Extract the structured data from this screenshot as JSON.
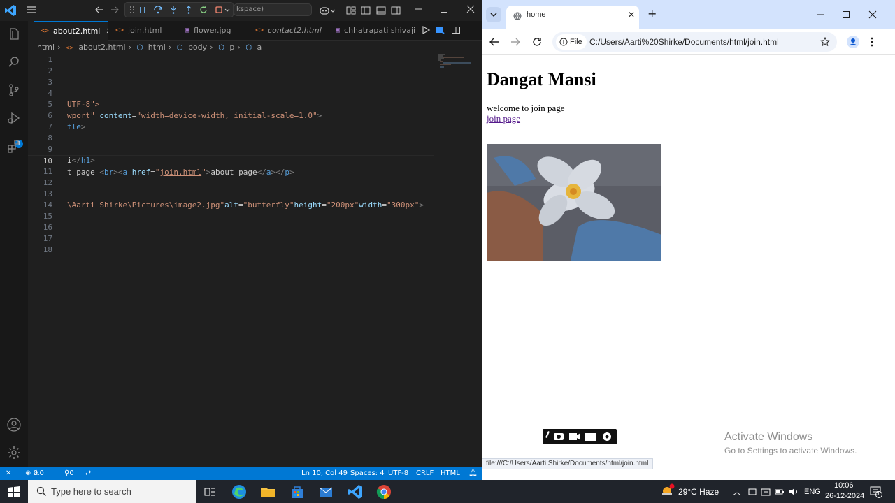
{
  "vscode": {
    "command_center_text": "kspace)",
    "tabs": [
      {
        "label": "about2.html",
        "icon": "<>",
        "active": true
      },
      {
        "label": "join.html",
        "icon": "<>",
        "active": false
      },
      {
        "label": "flower.jpg",
        "icon": "image",
        "active": false
      },
      {
        "label": "contact2.html",
        "icon": "<>",
        "active": false
      },
      {
        "label": "chhatrapati shivaji m",
        "icon": "image",
        "active": false
      }
    ],
    "breadcrumb": [
      "html",
      "about2.html",
      "html",
      "body",
      "p",
      "a"
    ],
    "line_numbers": [
      "1",
      "2",
      "3",
      "4",
      "5",
      "6",
      "7",
      "8",
      "9",
      "10",
      "11",
      "12",
      "13",
      "14",
      "15",
      "16",
      "17",
      "18"
    ],
    "current_line": "10",
    "code": {
      "l4": "UTF-8\">",
      "l5a": "wport\"",
      "l5b": "content",
      "l5c": "=",
      "l5d": "\"width=device-width, initial-scale=1.0\"",
      "l5e": ">",
      "l6a": "tle",
      "l6b": ">",
      "l9a": "i",
      "l9b": "</",
      "l9c": "h1",
      "l9d": ">",
      "l10a": "t page ",
      "l10b": "<",
      "l10c": "br",
      "l10d": "><",
      "l10e": "a",
      "l10f": "href",
      "l10g": "=",
      "l10h": "\"",
      "l10i": "join.html",
      "l10j": "\"",
      "l10k": ">",
      "l10l": "about page",
      "l10m": "</",
      "l10n": "a",
      "l10o": "></",
      "l10p": "p",
      "l10q": ">",
      "l13a": "\\Aarti Shirke\\Pictures\\image2.jpg\"",
      "l13b": "alt",
      "l13c": "=",
      "l13d": "\"butterfly\"",
      "l13e": "height",
      "l13f": "=",
      "l13g": "\"200px\"",
      "l13h": "width",
      "l13i": "=",
      "l13j": "\"300px\"",
      "l13k": ">"
    },
    "status": {
      "errors": "0",
      "warnings": "0",
      "ports": "0",
      "position": "Ln 10, Col 49",
      "spaces": "Spaces: 4",
      "encoding": "UTF-8",
      "eol": "CRLF",
      "language": "HTML"
    },
    "run_badge": "1"
  },
  "chrome": {
    "tab_title": "home",
    "omnibox_chip": "File",
    "url": "C:/Users/Aarti%20Shirke/Documents/html/join.html",
    "page": {
      "heading": "Dangat Mansi",
      "text": "welcome to join page",
      "link": "join page"
    },
    "status_url": "file:///C:/Users/Aarti Shirke/Documents/html/join.html"
  },
  "activate_windows": {
    "title": "Activate Windows",
    "subtitle": "Go to Settings to activate Windows."
  },
  "taskbar": {
    "search_placeholder": "Type here to search",
    "weather_temp": "29°C",
    "weather_desc": "Haze",
    "language": "ENG",
    "time": "10:06",
    "date": "26-12-2024",
    "notification_count": "3"
  },
  "colors": {
    "vscode_accent": "#0078d4",
    "chrome_tabstrip": "#d3e3fd",
    "link_visited": "#551a8b"
  }
}
